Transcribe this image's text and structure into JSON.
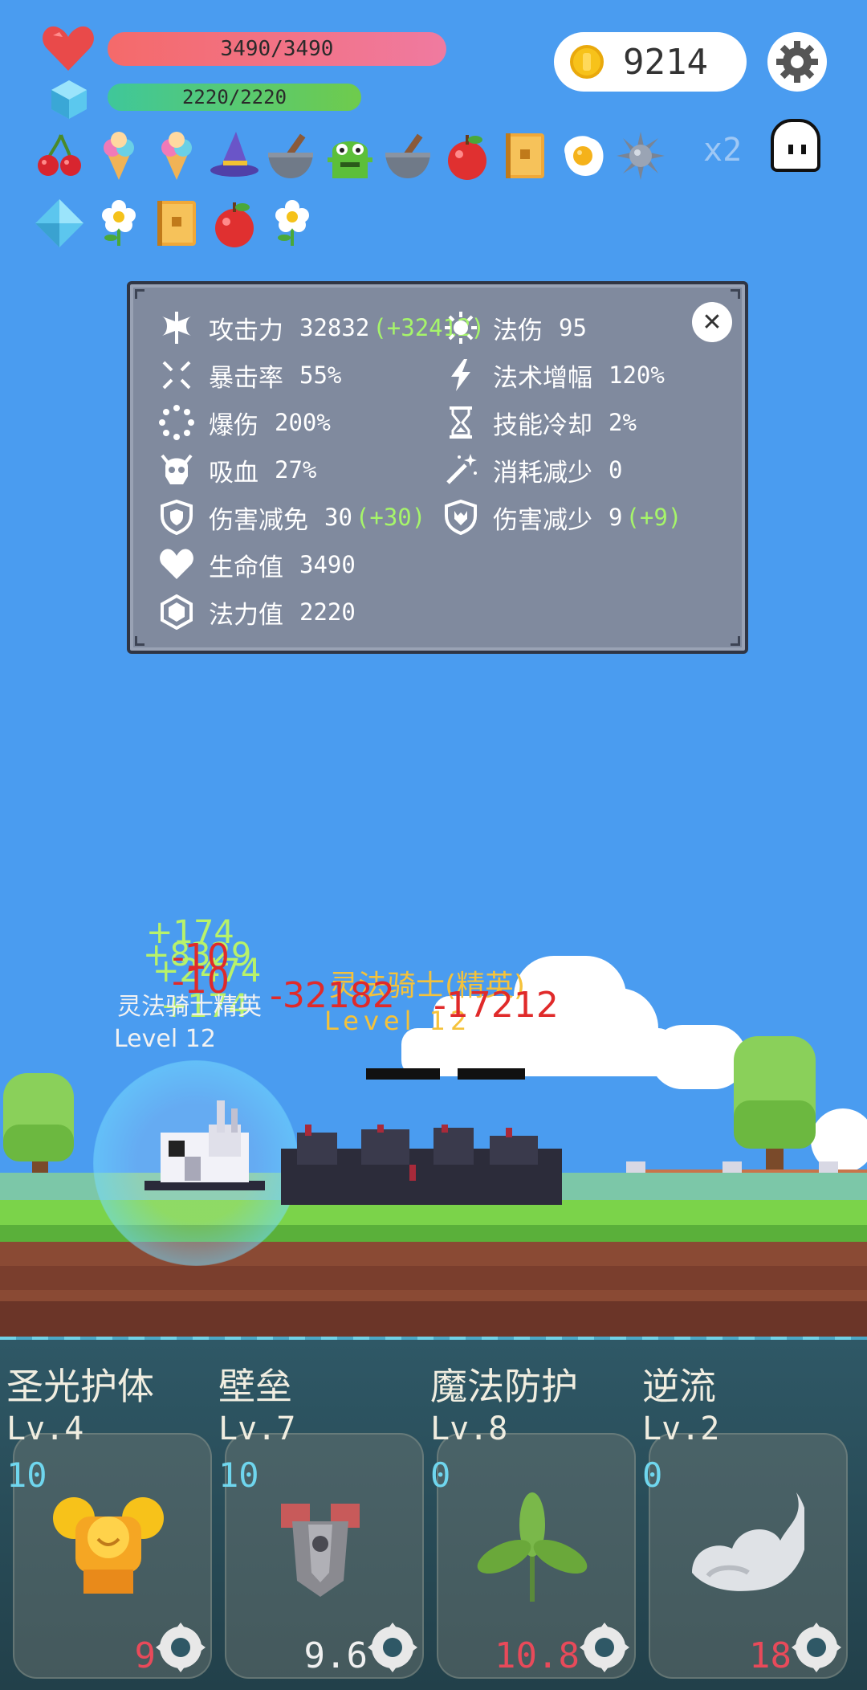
{
  "hud": {
    "hp_text": "3490/3490",
    "mp_text": "2220/2220",
    "coins": "9214",
    "speed": "x2"
  },
  "inventory_icons": [
    "cherry-icon",
    "ice-cream-icon",
    "ice-cream-icon",
    "wizard-hat-icon",
    "mortar-icon",
    "green-monster-icon",
    "mortar-icon",
    "apple-icon",
    "spell-book-icon",
    "fried-egg-icon",
    "spiked-ball-icon",
    "diamond-icon",
    "flower-icon",
    "spell-book-icon",
    "apple-icon",
    "flower-icon"
  ],
  "stats": {
    "attack": {
      "label": "攻击力",
      "value": "32832",
      "bonus": "(+32412)"
    },
    "magic_damage": {
      "label": "法伤",
      "value": "95"
    },
    "crit_rate": {
      "label": "暴击率",
      "value": "55%"
    },
    "spell_amp": {
      "label": "法术增幅",
      "value": "120%"
    },
    "crit_damage": {
      "label": "爆伤",
      "value": "200%"
    },
    "cooldown": {
      "label": "技能冷却",
      "value": "2%"
    },
    "lifesteal": {
      "label": "吸血",
      "value": "27%"
    },
    "cost_reduction": {
      "label": "消耗减少",
      "value": "0"
    },
    "damage_immunity": {
      "label": "伤害减免",
      "value": "30",
      "bonus": "(+30)"
    },
    "damage_reduction": {
      "label": "伤害减少",
      "value": "9",
      "bonus": "(+9)"
    },
    "hp": {
      "label": "生命值",
      "value": "3490"
    },
    "mp": {
      "label": "法力值",
      "value": "2220"
    }
  },
  "scene": {
    "heal_numbers": [
      "+174",
      "+8329",
      "+2474",
      "+174"
    ],
    "hero_damage": [
      "-10",
      "-10"
    ],
    "enemy_damage": [
      "-32182",
      "-17212"
    ],
    "enemy_name": "灵法骑士(精英)",
    "enemy_level": "Level 12",
    "hero_labels": [
      "灵法骑士精英",
      "Level 12"
    ]
  },
  "skills": [
    {
      "name": "圣光护体",
      "level": "Lv.4",
      "count": "10",
      "cooldown": "9",
      "cooldown_color": "#e84a5a"
    },
    {
      "name": "壁垒",
      "level": "Lv.7",
      "count": "10",
      "cooldown": "9.6",
      "cooldown_color": "#f0f0f0"
    },
    {
      "name": "魔法防护",
      "level": "Lv.8",
      "count": "0",
      "cooldown": "10.8",
      "cooldown_color": "#e84a5a"
    },
    {
      "name": "逆流",
      "level": "Lv.2",
      "count": "0",
      "cooldown": "18",
      "cooldown_color": "#e84a5a"
    }
  ]
}
